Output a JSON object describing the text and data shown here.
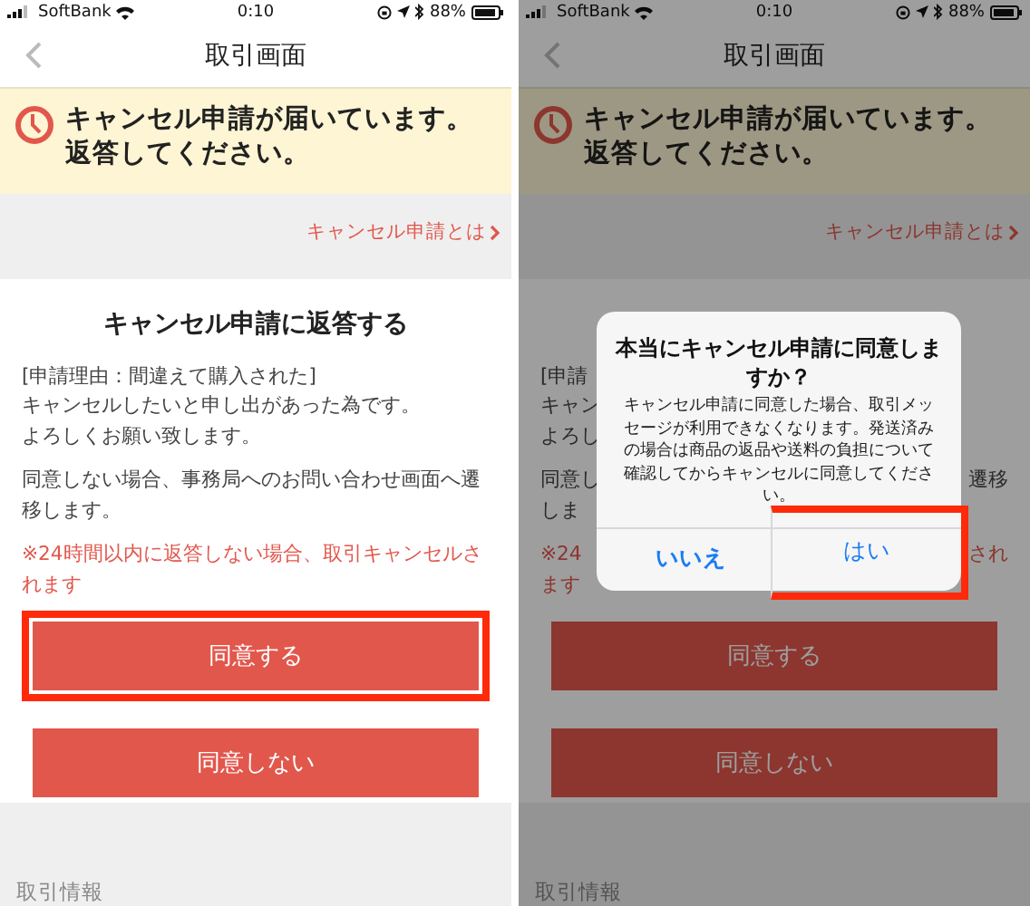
{
  "screens": [
    {
      "status_bar": {
        "carrier": "SoftBank",
        "time": "0:10",
        "battery": "88%"
      },
      "nav": {
        "title": "取引画面"
      },
      "banner": {
        "text": "キャンセル申請が届いています。返答してください。"
      },
      "link": {
        "text": "キャンセル申請とは"
      },
      "section": {
        "title": "キャンセル申請に返答する",
        "paragraphs": [
          {
            "lines": [
              {
                "left": "[申請理由：間違えて購入された]"
              },
              {
                "left": "キャンセルしたいと申し出があった為です。"
              },
              {
                "left": "よろしくお願い致します。"
              }
            ]
          },
          {
            "lines": [
              {
                "left": "同意しない場合、事務局へのお問い合わせ画面へ遷移します。"
              }
            ]
          }
        ],
        "warning": {
          "lines": [
            {
              "left": "※24時間以内に返答しない場合、取引キャンセルされます"
            }
          ]
        }
      },
      "buttons": [
        {
          "label": "同意する",
          "highlighted": true
        },
        {
          "label": "同意しない",
          "highlighted": false
        }
      ],
      "footer": {
        "label": "取引情報"
      }
    },
    {
      "status_bar": {
        "carrier": "SoftBank",
        "time": "0:10",
        "battery": "88%"
      },
      "nav": {
        "title": "取引画面"
      },
      "banner": {
        "text": "キャンセル申請が届いています。返答してください。"
      },
      "link": {
        "text": "キャンセル申請とは"
      },
      "section": {
        "paragraphs": [
          {
            "lines": [
              {
                "left": "[申請"
              },
              {
                "left": "キャン"
              },
              {
                "left": "よろし"
              }
            ]
          },
          {
            "lines": [
              {
                "left": "同意し",
                "right": "遷移"
              },
              {
                "left": "しま"
              }
            ]
          }
        ],
        "warning": {
          "lines": [
            {
              "left": "※24",
              "right": "され"
            },
            {
              "left": "ます"
            }
          ]
        }
      },
      "buttons": [
        {
          "label": "同意する",
          "highlighted": false
        },
        {
          "label": "同意しない",
          "highlighted": false
        }
      ],
      "footer": {
        "label": "取引情報"
      },
      "dialog": {
        "title": "本当にキャンセル申請に同意しますか？",
        "message": "キャンセル申請に同意した場合、取引メッセージが利用できなくなります。発送済みの場合は商品の返品や送料の負担について確認してからキャンセルに同意してください。",
        "buttons": [
          {
            "label": "いいえ",
            "kind": "cancel",
            "highlighted": false
          },
          {
            "label": "はい",
            "kind": "default",
            "highlighted": true
          }
        ]
      }
    }
  ]
}
